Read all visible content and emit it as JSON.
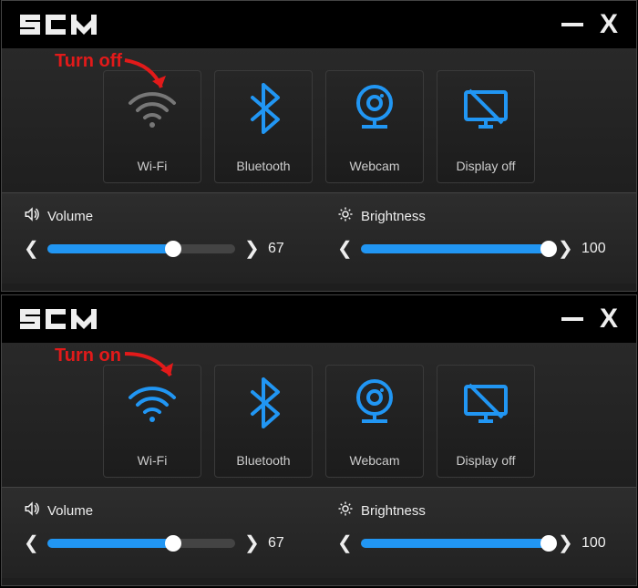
{
  "app_name": "SCM",
  "panels": [
    {
      "annotation": "Turn off",
      "wifi_active": false,
      "tiles": [
        {
          "id": "wifi",
          "label": "Wi-Fi"
        },
        {
          "id": "bluetooth",
          "label": "Bluetooth"
        },
        {
          "id": "webcam",
          "label": "Webcam"
        },
        {
          "id": "displayoff",
          "label": "Display off"
        }
      ],
      "volume": {
        "label": "Volume",
        "value": 67,
        "max": 100
      },
      "brightness": {
        "label": "Brightness",
        "value": 100,
        "max": 100
      }
    },
    {
      "annotation": "Turn on",
      "wifi_active": true,
      "tiles": [
        {
          "id": "wifi",
          "label": "Wi-Fi"
        },
        {
          "id": "bluetooth",
          "label": "Bluetooth"
        },
        {
          "id": "webcam",
          "label": "Webcam"
        },
        {
          "id": "displayoff",
          "label": "Display off"
        }
      ],
      "volume": {
        "label": "Volume",
        "value": 67,
        "max": 100
      },
      "brightness": {
        "label": "Brightness",
        "value": 100,
        "max": 100
      }
    }
  ],
  "colors": {
    "accent": "#2196f3",
    "inactive": "#777",
    "annotation": "#e21a1a"
  }
}
